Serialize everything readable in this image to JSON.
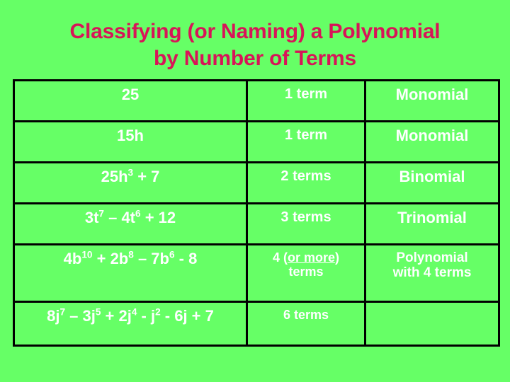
{
  "slide": {
    "background_color": "#66ff66",
    "title_color": "#d81458",
    "text_color": "#ffffff",
    "border_color": "#000000"
  },
  "title": {
    "line1": "Classifying (or Naming) a Polynomial",
    "line2": "by Number of Terms"
  },
  "table": {
    "rows": [
      {
        "expression": "25",
        "expression_parts": [
          {
            "text": "25"
          }
        ],
        "terms": "1 term",
        "name": "Monomial"
      },
      {
        "expression": "15h",
        "expression_parts": [
          {
            "text": "15h"
          }
        ],
        "terms": "1 term",
        "name": "Monomial"
      },
      {
        "expression": "25h3 + 7",
        "expression_parts": [
          {
            "text": "25h"
          },
          {
            "text": "3",
            "sup": true
          },
          {
            "text": " + 7"
          }
        ],
        "terms": "2 terms",
        "name": "Binomial"
      },
      {
        "expression": "3t7 – 4t6 + 12",
        "expression_parts": [
          {
            "text": "3t"
          },
          {
            "text": "7",
            "sup": true
          },
          {
            "text": " – 4t"
          },
          {
            "text": "6",
            "sup": true
          },
          {
            "text": " + 12"
          }
        ],
        "terms": "3 terms",
        "name": "Trinomial"
      },
      {
        "expression": "4b10 + 2b8 – 7b6 - 8",
        "expression_parts": [
          {
            "text": "4b"
          },
          {
            "text": "10",
            "sup": true
          },
          {
            "text": " + 2b"
          },
          {
            "text": "8",
            "sup": true
          },
          {
            "text": " – 7b"
          },
          {
            "text": "6",
            "sup": true
          },
          {
            "text": " - 8"
          }
        ],
        "terms": "4 (or more) terms",
        "terms_parts": [
          {
            "text": "4 ("
          },
          {
            "text": "or more",
            "underline": true
          },
          {
            "text": ")"
          },
          {
            "text": "terms",
            "newline": true
          }
        ],
        "name": "Polynomial with 4 terms",
        "name_parts": [
          {
            "text": "Polynomial"
          },
          {
            "text": "with 4 terms",
            "newline": true
          }
        ]
      },
      {
        "expression": "8j7 – 3j5 + 2j4 - j2 - 6j + 7",
        "expression_parts": [
          {
            "text": "8j"
          },
          {
            "text": "7",
            "sup": true
          },
          {
            "text": " – 3j"
          },
          {
            "text": "5",
            "sup": true
          },
          {
            "text": " + 2j"
          },
          {
            "text": "4",
            "sup": true
          },
          {
            "text": " - j"
          },
          {
            "text": "2",
            "sup": true
          },
          {
            "text": " - 6j + 7"
          }
        ],
        "terms": "6 terms",
        "name": ""
      }
    ]
  }
}
